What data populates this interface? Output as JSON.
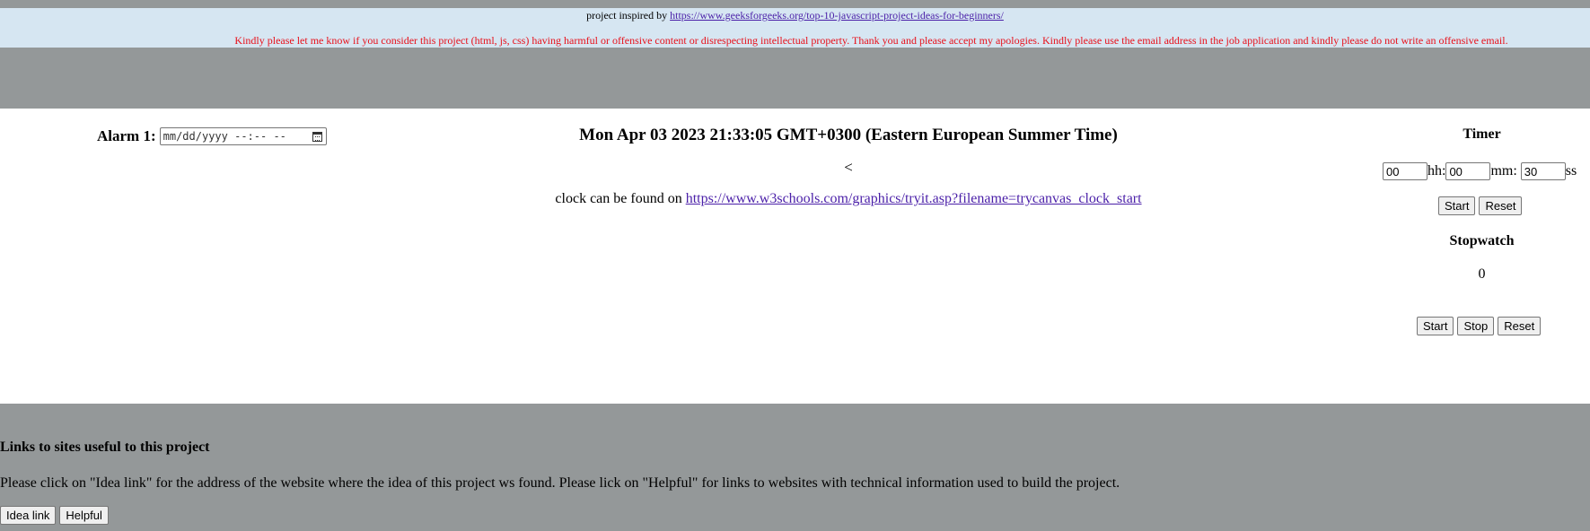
{
  "notice": {
    "inspired_prefix": "project inspired by ",
    "inspired_url": "https://www.geeksforgeeks.org/top-10-javascript-project-ideas-for-beginners/",
    "warning": "Kindly please let me know if you consider this project (html, js, css) having harmful or offensive content or disrespecting intellectual property. Thank you and please accept my apologies. Kindly please use the email address in the job application and kindly please do not write an offensive email."
  },
  "alarm": {
    "label": "Alarm 1:",
    "placeholder": "mm/dd/yyyy --:-- --",
    "icon": "calendar-icon"
  },
  "clock": {
    "datetime": "Mon Apr 03 2023 21:33:05 GMT+0300 (Eastern European Summer Time)",
    "lt": "<",
    "credit_prefix": "clock can be found on ",
    "credit_url": "https://www.w3schools.com/graphics/tryit.asp?filename=trycanvas_clock_start"
  },
  "timer": {
    "title": "Timer",
    "hh_value": "00",
    "hh_label": "hh:",
    "mm_value": "00",
    "mm_label": "mm:",
    "ss_value": "30",
    "ss_label": "ss",
    "start_label": "Start",
    "reset_label": "Reset"
  },
  "stopwatch": {
    "title": "Stopwatch",
    "value": "0",
    "start_label": "Start",
    "stop_label": "Stop",
    "reset_label": "Reset"
  },
  "footer": {
    "heading": "Links to sites useful to this project",
    "text": "Please click on \"Idea link\" for the address of the website where the idea of this project ws found. Please lick on \"Helpful\" for links to websites with technical information used to build the project.",
    "idea_label": "Idea link",
    "helpful_label": "Helpful"
  },
  "colors": {
    "grey_band": "#949899",
    "notice_bg": "#d6e6f2",
    "warning_text": "#e8101a",
    "link": "#4a1fa8"
  }
}
